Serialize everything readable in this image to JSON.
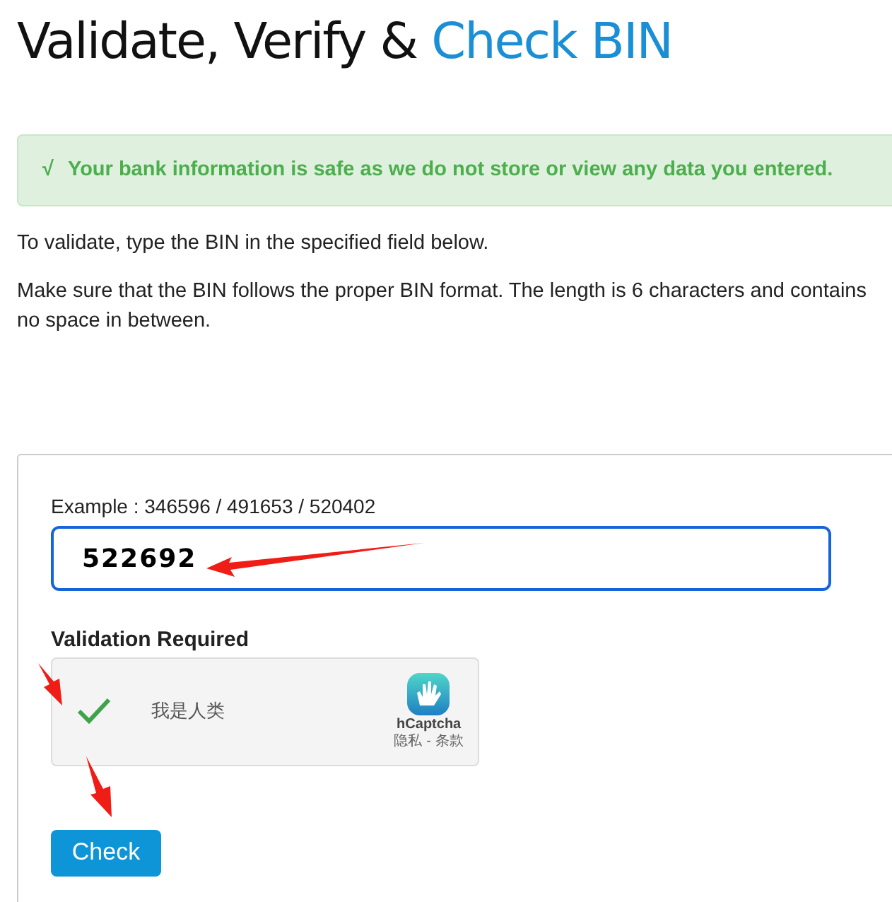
{
  "title": {
    "text": "Validate, Verify & ",
    "highlight": "Check BIN"
  },
  "alert": {
    "icon": "√",
    "text": "Your bank information is safe as we do not store or view any data you entered."
  },
  "paragraphs": [
    "To validate, type the BIN in the specified field below.",
    "Make sure that the BIN follows the proper BIN format. The length is 6 characters and contains no space in between."
  ],
  "form": {
    "example_label": "Example : 346596 / 491653 / 520402",
    "bin_field": {
      "value": "522692"
    },
    "validation_label": "Validation Required",
    "captcha": {
      "checked": true,
      "label": "我是人类",
      "brand": "hCaptcha",
      "links": [
        "隐私",
        "条款"
      ],
      "separator": "-"
    },
    "submit_button": "Check"
  }
}
